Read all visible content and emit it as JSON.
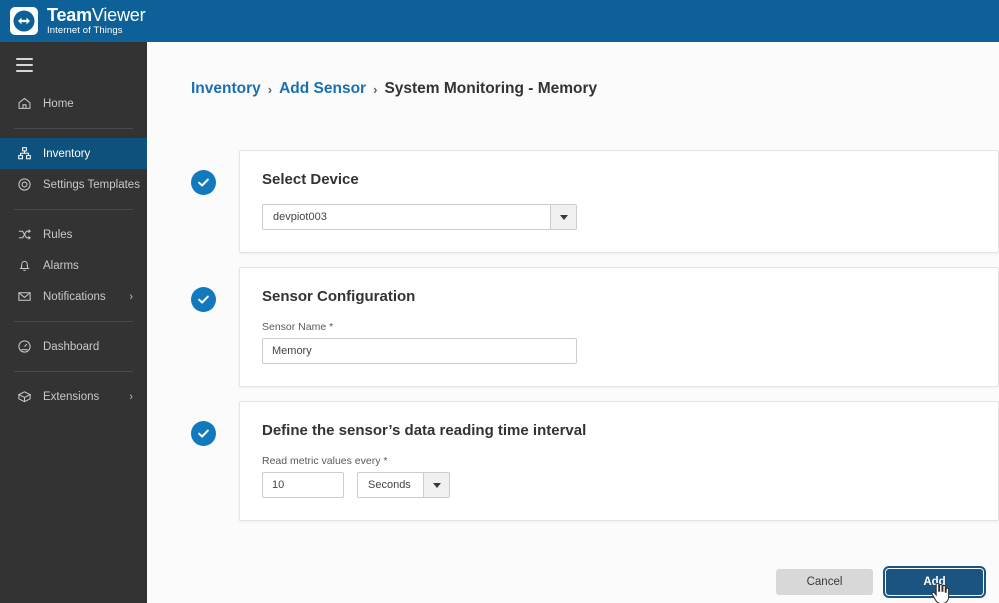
{
  "brand": {
    "name_bold": "Team",
    "name_light": "Viewer",
    "tagline": "Internet of Things",
    "logo_icon": "teamviewer-arrows-icon",
    "bar_color": "#0d6198"
  },
  "sidebar": {
    "menu_icon": "hamburger-menu-icon",
    "active_color": "#0f517d",
    "items": [
      {
        "label": "Home",
        "icon": "home-icon",
        "active": false,
        "chevron": ""
      },
      {
        "label": "Inventory",
        "icon": "inventory-icon",
        "active": true,
        "chevron": ""
      },
      {
        "label": "Settings Templates",
        "icon": "gear-target-icon",
        "active": false,
        "chevron": ""
      },
      {
        "label": "Rules",
        "icon": "rules-shuffle-icon",
        "active": false,
        "chevron": ""
      },
      {
        "label": "Alarms",
        "icon": "bell-icon",
        "active": false,
        "chevron": ""
      },
      {
        "label": "Notifications",
        "icon": "envelope-icon",
        "active": false,
        "chevron": "›"
      },
      {
        "label": "Dashboard",
        "icon": "dashboard-gauge-icon",
        "active": false,
        "chevron": ""
      },
      {
        "label": "Extensions",
        "icon": "extensions-box-icon",
        "active": false,
        "chevron": "›"
      }
    ]
  },
  "breadcrumb": {
    "item1": "Inventory",
    "separator1": "›",
    "item2": "Add Sensor",
    "separator2": "›",
    "current": "System Monitoring - Memory"
  },
  "steps": [
    {
      "state_icon": "check-circle-icon",
      "title": "Select Device",
      "device_select": {
        "value": "devpiot003",
        "caret_icon": "chevron-down-icon"
      }
    },
    {
      "state_icon": "check-circle-icon",
      "title": "Sensor Configuration",
      "sensor_name": {
        "label": "Sensor Name *",
        "value": "Memory",
        "placeholder": "Sensor Name"
      }
    },
    {
      "state_icon": "check-circle-icon",
      "title": "Define the sensor’s data reading time interval",
      "interval": {
        "label": "Read metric values every *",
        "value": "10",
        "placeholder": "10",
        "unit": "Seconds",
        "caret_icon": "chevron-down-icon"
      }
    }
  ],
  "footer": {
    "cancel_label": "Cancel",
    "add_label": "Add",
    "add_color": "#1b5480"
  },
  "cursor": {
    "icon": "hand-pointer-cursor"
  }
}
